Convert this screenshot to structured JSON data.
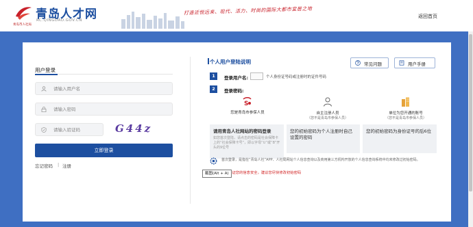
{
  "header": {
    "logo_title": "青岛人才网",
    "logo_url": "RC.QINGDAO.GOV.CN",
    "logo_small": "青岛市人社局",
    "slogan": "打造近悦远来、现代、活力、时尚的国际大都市宜居之地",
    "home_link": "返回首页"
  },
  "login": {
    "tab_label": "用户登录",
    "username_placeholder": "请输入用户名",
    "password_placeholder": "请输入密码",
    "captcha_placeholder": "请输入验证码",
    "captcha_text": "G44z",
    "login_button": "立即登录",
    "forgot_password": "忘记密码",
    "separator": "|",
    "register": "注册"
  },
  "instructions": {
    "title": "个人用户登陆说明",
    "faq_button": "常见问题",
    "manual_button": "用户手册",
    "step1_num": "1",
    "step1_label": "登录用户名:",
    "step1_desc": "个人身份证号码或注册时的证件号码",
    "step2_num": "2",
    "step2_label": "登录密码:",
    "options": [
      {
        "label": "您是青岛市参保人员",
        "sub": ""
      },
      {
        "label": "自主注册人员",
        "sub": "（您不是青岛市参保人员）"
      },
      {
        "label": "单位为您开通的账号",
        "sub": "（您不是青岛市参保人员）"
      }
    ],
    "box1_title": "请用青岛人社网站的密码登录",
    "box1_sub": "如您首次登陆，请点击的密码是社会保障卡上的“社会保障卡号”，即以字母“U”或“B”开头的9位号",
    "box2_text": "您的初始密码为个人注册时自己设置的密码",
    "box3_text": "您的初始密码为身份证号的后6位",
    "notice": "首次登录，是指在“青岛人社”APP、人社局网站个人信息查询以及商用第三方机构开放的个人信息查询系统中均未修改过初始密码。",
    "red_note": "登录，为保证您的信息安全，建议您尽快修改初始密码",
    "tooltip": "截图(Alt + A)"
  },
  "colors": {
    "brand_blue": "#1d4fa0",
    "background_blue": "#3f6fc2",
    "slogan_red": "#c8202a",
    "warning_red": "#d02020"
  }
}
